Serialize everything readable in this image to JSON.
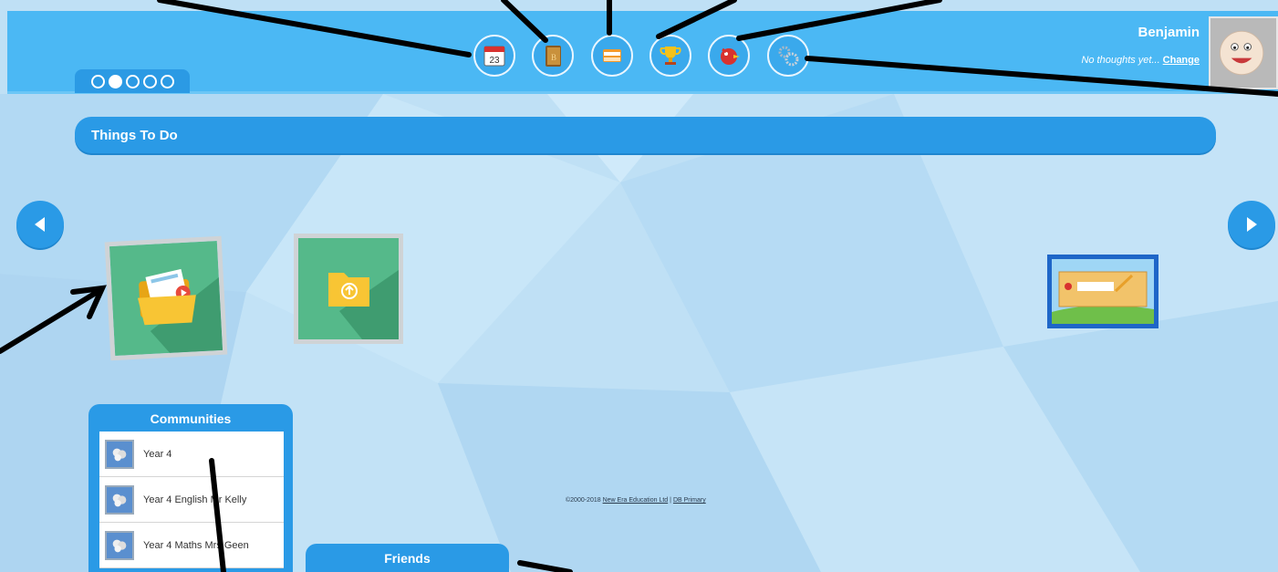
{
  "header": {
    "pager": {
      "count": 5,
      "active_index": 1
    },
    "toolbar": [
      {
        "name": "calendar-icon",
        "day": "23"
      },
      {
        "name": "book-icon",
        "letter": "B"
      },
      {
        "name": "folders-icon"
      },
      {
        "name": "trophy-icon"
      },
      {
        "name": "bird-icon"
      },
      {
        "name": "settings-gears-icon"
      }
    ],
    "user": {
      "name": "Benjamin",
      "thought": "No thoughts yet...",
      "change_link": "Change"
    }
  },
  "main": {
    "section_title": "Things To Do",
    "prev_icon": "arrow-left-icon",
    "next_icon": "arrow-right-icon"
  },
  "communities": {
    "title": "Communities",
    "items": [
      {
        "label": "Year 4"
      },
      {
        "label": "Year 4 English Mr Kelly"
      },
      {
        "label": "Year 4 Maths Mrs Geen"
      }
    ]
  },
  "friends": {
    "title": "Friends"
  },
  "footer": {
    "copyright": "©2000-2018",
    "company_link": "New Era Education Ltd",
    "separator": "|",
    "product_link": "DB Primary"
  },
  "colors": {
    "header": "#4bb8f4",
    "accent": "#2a9ae6",
    "background": "#bfe0f5"
  }
}
